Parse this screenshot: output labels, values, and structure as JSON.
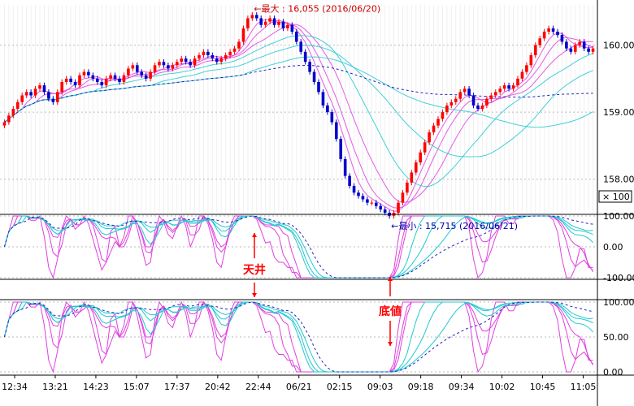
{
  "colors": {
    "up_candle": "#ff0000",
    "down_candle": "#0000cc",
    "ma_cyan": "#22c8d0",
    "ma_magenta": "#e040e0",
    "dashed_blue": "#2020c0",
    "annotation_red": "#cc0000",
    "annotation_blue": "#0000aa",
    "marker_red": "#ff0000"
  },
  "chart_data": [
    {
      "type": "candlestick",
      "panel": "price",
      "ylim": [
        157.5,
        160.6
      ],
      "y_ticks": [
        "160.00",
        "159.00",
        "158.00"
      ],
      "y_tick_values": [
        160.0,
        159.0,
        158.0
      ],
      "scale_label": "× 100",
      "x_tick_labels": [
        "12:34",
        "13:21",
        "14:23",
        "15:07",
        "17:37",
        "20:42",
        "22:44",
        "06/21",
        "02:15",
        "09:03",
        "09:18",
        "09:34",
        "10:02",
        "10:45",
        "11:05"
      ],
      "close_series": [
        158.85,
        158.95,
        159.05,
        159.15,
        159.25,
        159.3,
        159.25,
        159.35,
        159.4,
        159.3,
        159.2,
        159.15,
        159.3,
        159.45,
        159.5,
        159.45,
        159.4,
        159.55,
        159.6,
        159.55,
        159.5,
        159.45,
        159.4,
        159.5,
        159.55,
        159.5,
        159.45,
        159.55,
        159.65,
        159.7,
        159.6,
        159.55,
        159.5,
        159.6,
        159.7,
        159.75,
        159.7,
        159.65,
        159.7,
        159.75,
        159.8,
        159.75,
        159.7,
        159.8,
        159.85,
        159.9,
        159.85,
        159.8,
        159.75,
        159.8,
        159.85,
        159.9,
        159.95,
        160.05,
        160.25,
        160.4,
        160.45,
        160.4,
        160.3,
        160.35,
        160.4,
        160.3,
        160.35,
        160.25,
        160.3,
        160.2,
        160.05,
        159.9,
        159.75,
        159.6,
        159.45,
        159.3,
        159.1,
        159.0,
        158.85,
        158.6,
        158.3,
        158.05,
        157.9,
        157.8,
        157.75,
        157.7,
        157.65,
        157.65,
        157.6,
        157.55,
        157.5,
        157.45,
        157.5,
        157.65,
        157.8,
        157.95,
        158.1,
        158.25,
        158.4,
        158.55,
        158.7,
        158.8,
        158.9,
        159.0,
        159.1,
        159.15,
        159.2,
        159.3,
        159.35,
        159.25,
        159.1,
        159.05,
        159.1,
        159.2,
        159.25,
        159.3,
        159.35,
        159.4,
        159.35,
        159.4,
        159.5,
        159.6,
        159.7,
        159.85,
        160.0,
        160.1,
        160.2,
        160.25,
        160.2,
        160.15,
        160.05,
        159.95,
        159.9,
        160.0,
        160.05,
        159.95,
        159.9,
        159.95
      ],
      "ma_series": [
        {
          "color": "#e040e0",
          "period": 5
        },
        {
          "color": "#e040e0",
          "period": 8
        },
        {
          "color": "#e040e0",
          "period": 13
        },
        {
          "color": "#22c8d0",
          "period": 21
        },
        {
          "color": "#22c8d0",
          "period": 34
        },
        {
          "color": "#22c8d0",
          "period": 55
        }
      ],
      "annotations": [
        {
          "text": "←最大 : 16,055 (2016/06/20)",
          "color": "#cc0000",
          "index": 56
        },
        {
          "text": "←最小 : 15,715 (2016/06/21)",
          "color": "#0000aa",
          "index": 87
        }
      ]
    },
    {
      "type": "line",
      "panel": "oscillator-1",
      "ylim": [
        -100,
        100
      ],
      "y_ticks": [
        "100.00",
        "0.00",
        "-100.00"
      ],
      "y_tick_values": [
        100,
        0,
        -100
      ],
      "marker_labels": [
        "天井"
      ]
    },
    {
      "type": "line",
      "panel": "oscillator-2",
      "ylim": [
        0,
        100
      ],
      "y_ticks": [
        "100.00",
        "50.00",
        "0.00"
      ],
      "y_tick_values": [
        100,
        50,
        0
      ],
      "marker_labels": [
        "底値"
      ]
    }
  ]
}
